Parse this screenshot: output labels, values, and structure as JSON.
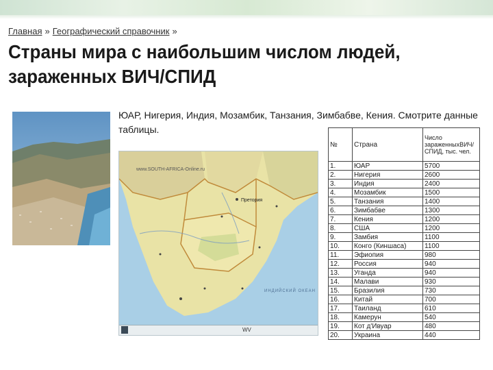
{
  "breadcrumb": {
    "home": "Главная",
    "separator": "»",
    "section": "Географический справочник"
  },
  "title": "Страны мира с наибольшим числом людей, зараженных ВИЧ/СПИД",
  "intro": "ЮАР, Нигерия, Индия, Мозамбик, Танзания, Зимбабве, Кения. Смотрите данные таблицы.",
  "map": {
    "watermark": "www.SOUTH-AFRICA-Online.ru",
    "code": "WV",
    "ocean_label": "ИНДИЙСКИЙ ОКЕАН",
    "city_label": "Претория"
  },
  "table": {
    "headers": [
      "№",
      "Страна",
      "Число зараженныхВИЧ/СПИД, тыс. чел."
    ],
    "rows": [
      [
        "1.",
        "ЮАР",
        "5700"
      ],
      [
        "2.",
        "Нигерия",
        "2600"
      ],
      [
        "3.",
        "Индия",
        "2400"
      ],
      [
        "4.",
        "Мозамбик",
        "1500"
      ],
      [
        "5.",
        "Танзания",
        "1400"
      ],
      [
        "6.",
        "Зимбабве",
        "1300"
      ],
      [
        "7.",
        "Кения",
        "1200"
      ],
      [
        "8.",
        "США",
        "1200"
      ],
      [
        "9.",
        "Замбия",
        "1100"
      ],
      [
        "10.",
        "Конго (Киншаса)",
        "1100"
      ],
      [
        "11.",
        "Эфиопия",
        "980"
      ],
      [
        "12.",
        "Россия",
        "940"
      ],
      [
        "13.",
        "Уганда",
        "940"
      ],
      [
        "14.",
        "Малави",
        "930"
      ],
      [
        "15.",
        "Бразилия",
        "730"
      ],
      [
        "16.",
        "Китай",
        "700"
      ],
      [
        "17.",
        "Таиланд",
        "610"
      ],
      [
        "18.",
        "Камерун",
        "540"
      ],
      [
        "19.",
        "Кот д'Ивуар",
        "480"
      ],
      [
        "20.",
        "Украина",
        "440"
      ]
    ]
  },
  "colors": {
    "land": "#e9e3a6",
    "sea": "#a9cfe6",
    "border": "#c08a3a"
  }
}
